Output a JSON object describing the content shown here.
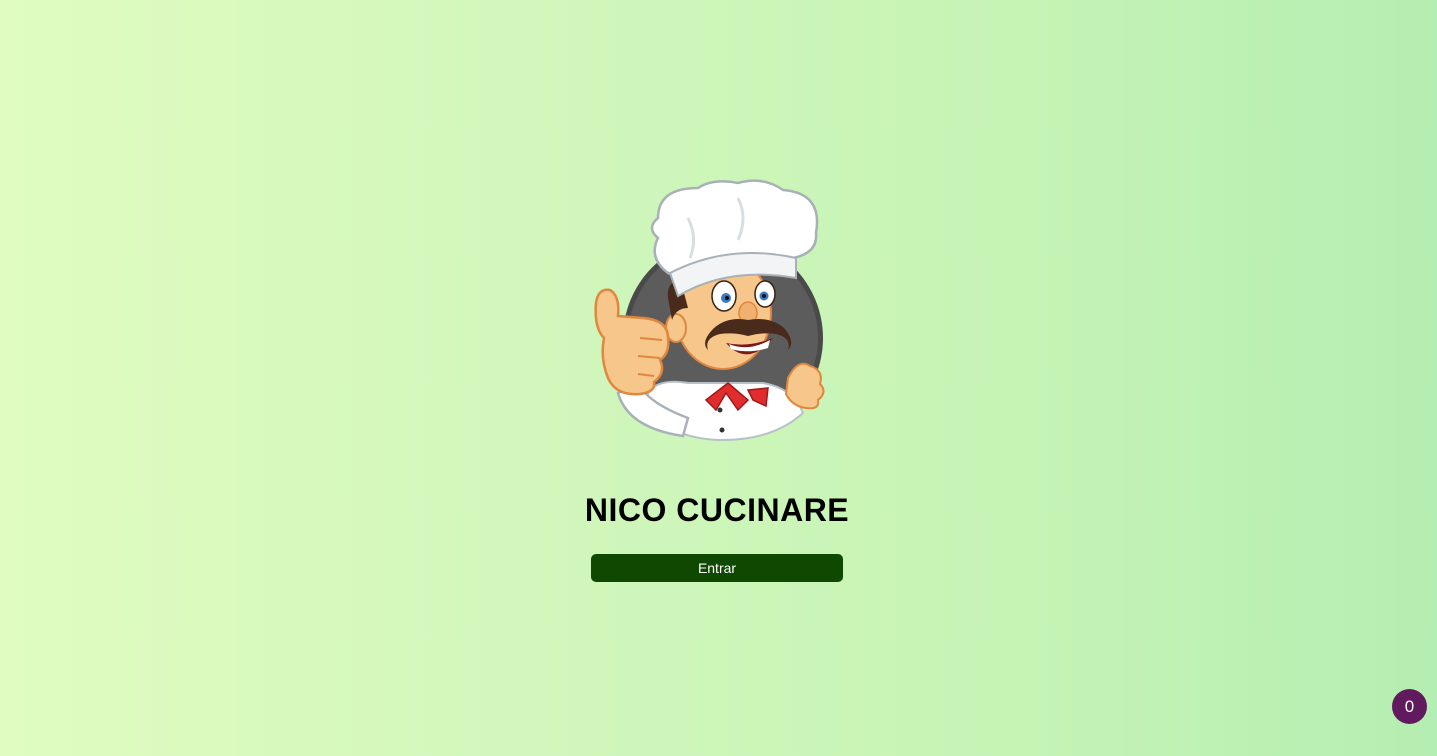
{
  "app": {
    "title": "NICO CUCINARE"
  },
  "logo": {
    "icon": "chef-mascot-icon"
  },
  "actions": {
    "enter_label": "Entrar"
  },
  "badge": {
    "count": "0",
    "color": "#611a5e"
  },
  "colors": {
    "button_bg": "#0f4800",
    "background_start": "#e0fcc0",
    "background_end": "#b5eeb2"
  }
}
